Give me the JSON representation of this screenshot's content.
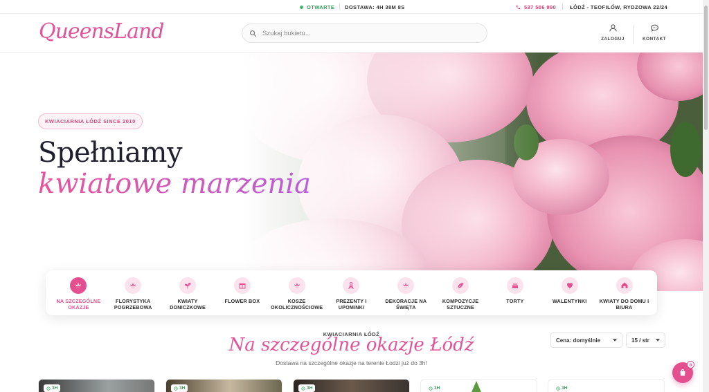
{
  "topbar": {
    "status": "OTWARTE",
    "delivery": "DOSTAWA: 4H 38M 8S",
    "phone": "537 506 990",
    "address": "ŁÓDŹ - TEOFILÓW, RYDZOWA 22/24"
  },
  "header": {
    "logo": "QueensLand",
    "search_placeholder": "Szukaj bukietu...",
    "login_label": "ZALOGUJ",
    "contact_label": "KONTAKT"
  },
  "hero": {
    "badge": "KWIACIARNIA ŁÓDŹ SINCE 2010",
    "title_line1": "Spełniamy",
    "title_line2": "kwiatowe marzenia"
  },
  "categories": [
    {
      "label": "NA SZCZEGÓLNE OKAZJE",
      "icon": "lotus-icon",
      "active": true
    },
    {
      "label": "FLORYSTYKA POGRZEBOWA",
      "icon": "lotus-icon"
    },
    {
      "label": "KWIATY DONICZKOWE",
      "icon": "sprout-icon"
    },
    {
      "label": "FLOWER BOX",
      "icon": "gift-icon"
    },
    {
      "label": "KOSZE OKOLICZNOŚCIOWE",
      "icon": "lotus-icon"
    },
    {
      "label": "PREZENTY I UPOMINKI",
      "icon": "ribbon-icon"
    },
    {
      "label": "DEKORACJE NA ŚWIĘTA",
      "icon": "lotus-icon"
    },
    {
      "label": "KOMPOZYCJE SZTUCZNE",
      "icon": "leaf-icon"
    },
    {
      "label": "TORTY",
      "icon": "cake-icon"
    },
    {
      "label": "WALENTYNKI",
      "icon": "heart-icon"
    },
    {
      "label": "KWIATY DO DOMU I BIURA",
      "icon": "home-icon"
    }
  ],
  "section": {
    "eyebrow": "KWIACIARNIA ŁÓDŹ",
    "title": "Na szczególne okazje Łódź",
    "subtitle": "Dostawa na szczególne okazje na terenie Łodzi już do 3h!",
    "sort_select": "Cena: domyślnie",
    "per_page_select": "15 / str"
  },
  "products": [
    {
      "badge": "3H"
    },
    {
      "badge": "3H"
    },
    {
      "badge": "3H"
    },
    {
      "badge": "3H"
    },
    {
      "badge": "3H"
    }
  ],
  "cart": {
    "count": "0"
  },
  "colors": {
    "accent": "#e4508f",
    "open": "#2e9e57"
  }
}
